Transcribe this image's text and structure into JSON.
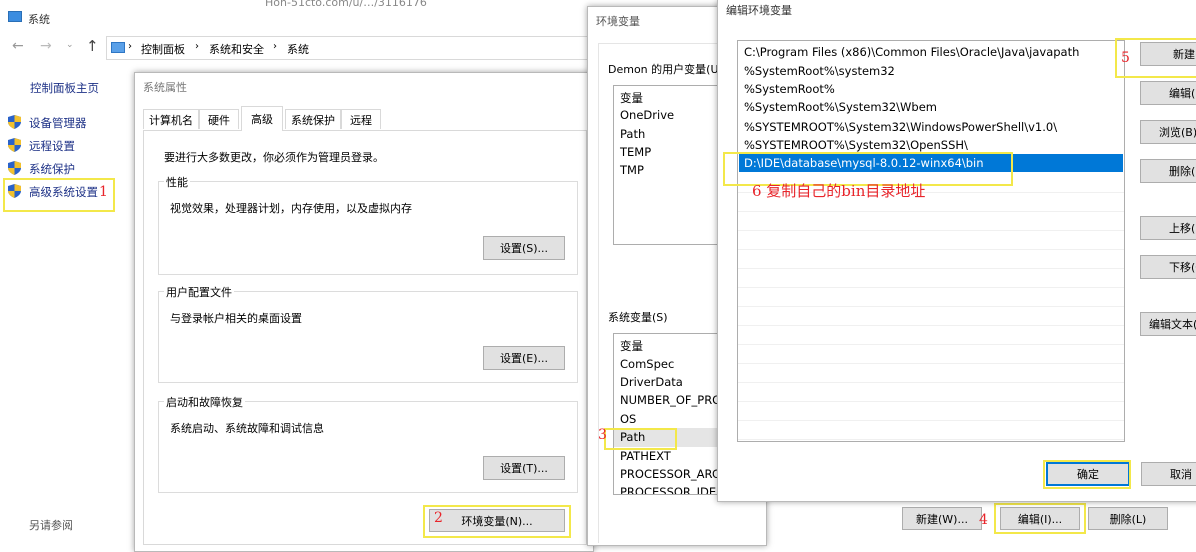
{
  "explorer": {
    "title": "系统",
    "bg_title_fragment": "Hon-51cto.com/u/…/3116176",
    "breadcrumb": [
      "控制面板",
      "系统和安全",
      "系统"
    ],
    "sidebar_home": "控制面板主页",
    "sidebar_items": [
      "设备管理器",
      "远程设置",
      "系统保护",
      "高级系统设置"
    ],
    "see_also": "另请参阅"
  },
  "sysprops": {
    "title": "系统属性",
    "tabs": [
      "计算机名",
      "硬件",
      "高级",
      "系统保护",
      "远程"
    ],
    "active_tab": "高级",
    "admin_note": "要进行大多数更改，你必须作为管理员登录。",
    "perf_title": "性能",
    "perf_desc": "视觉效果，处理器计划，内存使用，以及虚拟内存",
    "perf_btn": "设置(S)...",
    "profile_title": "用户配置文件",
    "profile_desc": "与登录帐户相关的桌面设置",
    "profile_btn": "设置(E)...",
    "startup_title": "启动和故障恢复",
    "startup_desc": "系统启动、系统故障和调试信息",
    "startup_btn": "设置(T)...",
    "env_btn": "环境变量(N)..."
  },
  "envvars": {
    "title": "环境变量",
    "user_vars_label": "Demon 的用户变量(U)",
    "user_col": "变量",
    "user_vars": [
      "OneDrive",
      "Path",
      "TEMP",
      "TMP"
    ],
    "sys_vars_label": "系统变量(S)",
    "sys_col": "变量",
    "sys_vars": [
      "ComSpec",
      "DriverData",
      "NUMBER_OF_PRO",
      "OS",
      "Path",
      "PATHEXT",
      "PROCESSOR_ARC",
      "PROCESSOR_IDEN"
    ],
    "new_btn": "新建(W)...",
    "edit_btn": "编辑(I)...",
    "delete_btn": "删除(L)"
  },
  "editenv": {
    "title": "编辑环境变量",
    "paths": [
      "C:\\Program Files (x86)\\Common Files\\Oracle\\Java\\javapath",
      "%SystemRoot%\\system32",
      "%SystemRoot%",
      "%SystemRoot%\\System32\\Wbem",
      "%SYSTEMROOT%\\System32\\WindowsPowerShell\\v1.0\\",
      "%SYSTEMROOT%\\System32\\OpenSSH\\",
      "D:\\IDE\\database\\mysql-8.0.12-winx64\\bin"
    ],
    "selected_index": 6,
    "buttons": [
      "新建(N",
      "编辑(E",
      "浏览(B)",
      "删除(D",
      "上移(U",
      "下移(O",
      "编辑文本("
    ],
    "ok": "确定",
    "cancel": "取消"
  },
  "annotations": {
    "n1": "1",
    "n2": "2",
    "n3": "3",
    "n4": "4",
    "n5": "5",
    "n6": "6 复制自己的bin目录地址"
  },
  "colors": {
    "accent": "#0078d7",
    "highlight": "#f3e84a",
    "annotation_red": "#e8252b"
  }
}
